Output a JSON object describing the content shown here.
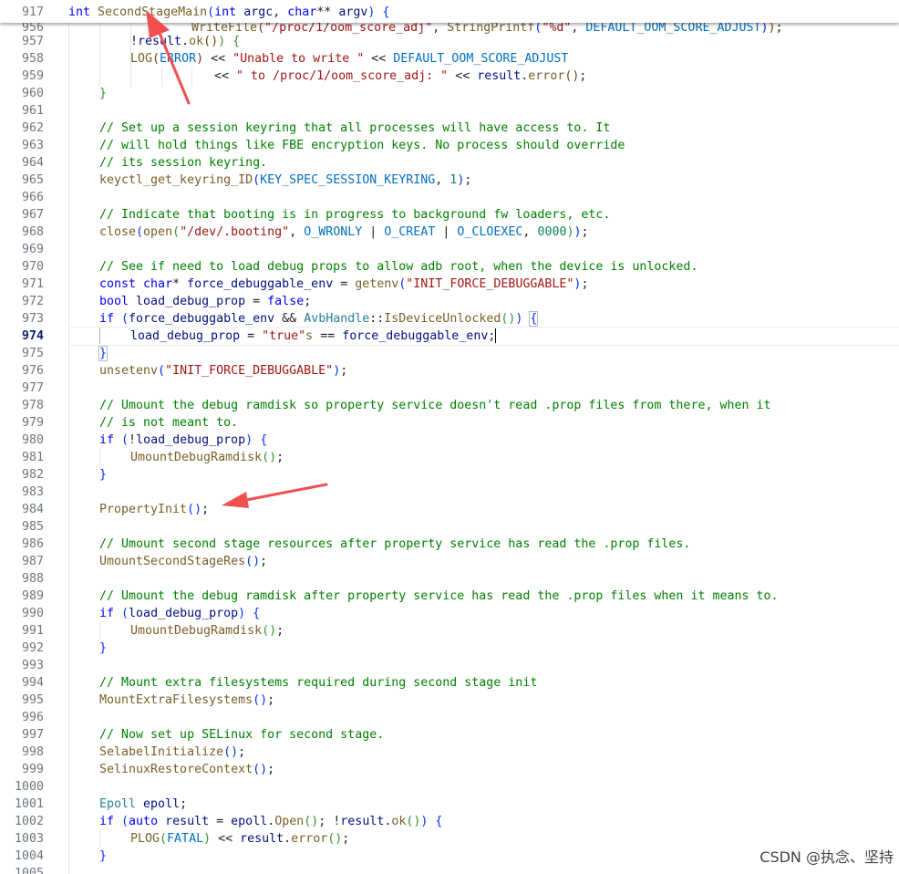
{
  "editor": {
    "active_line": "974",
    "sticky": {
      "line_number": "917",
      "code": "int SecondStageMain(int argc, char** argv) {"
    },
    "lines": [
      {
        "n": "957",
        "code": "!result.ok()) {"
      },
      {
        "n": "958",
        "code": "LOG(ERROR) << \"Unable to write \" << DEFAULT_OOM_SCORE_ADJUST"
      },
      {
        "n": "959",
        "code": "<< \" to /proc/1/oom_score_adj: \" << result.error();"
      },
      {
        "n": "960",
        "code": "}"
      },
      {
        "n": "961",
        "code": ""
      },
      {
        "n": "962",
        "code": "// Set up a session keyring that all processes will have access to. It"
      },
      {
        "n": "963",
        "code": "// will hold things like FBE encryption keys. No process should override"
      },
      {
        "n": "964",
        "code": "// its session keyring."
      },
      {
        "n": "965",
        "code": "keyctl_get_keyring_ID(KEY_SPEC_SESSION_KEYRING, 1);"
      },
      {
        "n": "966",
        "code": ""
      },
      {
        "n": "967",
        "code": "// Indicate that booting is in progress to background fw loaders, etc."
      },
      {
        "n": "968",
        "code": "close(open(\"/dev/.booting\", O_WRONLY | O_CREAT | O_CLOEXEC, 0000));"
      },
      {
        "n": "969",
        "code": ""
      },
      {
        "n": "970",
        "code": "// See if need to load debug props to allow adb root, when the device is unlocked."
      },
      {
        "n": "971",
        "code": "const char* force_debuggable_env = getenv(\"INIT_FORCE_DEBUGGABLE\");"
      },
      {
        "n": "972",
        "code": "bool load_debug_prop = false;"
      },
      {
        "n": "973",
        "code": "if (force_debuggable_env && AvbHandle::IsDeviceUnlocked()) {"
      },
      {
        "n": "974",
        "code": "load_debug_prop = \"true\"s == force_debuggable_env;"
      },
      {
        "n": "975",
        "code": "}"
      },
      {
        "n": "976",
        "code": "unsetenv(\"INIT_FORCE_DEBUGGABLE\");"
      },
      {
        "n": "977",
        "code": ""
      },
      {
        "n": "978",
        "code": "// Umount the debug ramdisk so property service doesn't read .prop files from there, when it"
      },
      {
        "n": "979",
        "code": "// is not meant to."
      },
      {
        "n": "980",
        "code": "if (!load_debug_prop) {"
      },
      {
        "n": "981",
        "code": "UmountDebugRamdisk();"
      },
      {
        "n": "982",
        "code": "}"
      },
      {
        "n": "983",
        "code": ""
      },
      {
        "n": "984",
        "code": "PropertyInit();"
      },
      {
        "n": "985",
        "code": ""
      },
      {
        "n": "986",
        "code": "// Umount second stage resources after property service has read the .prop files."
      },
      {
        "n": "987",
        "code": "UmountSecondStageRes();"
      },
      {
        "n": "988",
        "code": ""
      },
      {
        "n": "989",
        "code": "// Umount the debug ramdisk after property service has read the .prop files when it means to."
      },
      {
        "n": "990",
        "code": "if (load_debug_prop) {"
      },
      {
        "n": "991",
        "code": "UmountDebugRamdisk();"
      },
      {
        "n": "992",
        "code": "}"
      },
      {
        "n": "993",
        "code": ""
      },
      {
        "n": "994",
        "code": "// Mount extra filesystems required during second stage init"
      },
      {
        "n": "995",
        "code": "MountExtraFilesystems();"
      },
      {
        "n": "996",
        "code": ""
      },
      {
        "n": "997",
        "code": "// Now set up SELinux for second stage."
      },
      {
        "n": "998",
        "code": "SelabelInitialize();"
      },
      {
        "n": "999",
        "code": "SelinuxRestoreContext();"
      },
      {
        "n": "1000",
        "code": ""
      },
      {
        "n": "1001",
        "code": "Epoll epoll;"
      },
      {
        "n": "1002",
        "code": "if (auto result = epoll.Open(); !result.ok()) {"
      },
      {
        "n": "1003",
        "code": "PLOG(FATAL) << result.error();"
      },
      {
        "n": "1004",
        "code": "}"
      }
    ]
  },
  "watermark": "CSDN @执念、坚持",
  "annotation_color": "#f05050"
}
